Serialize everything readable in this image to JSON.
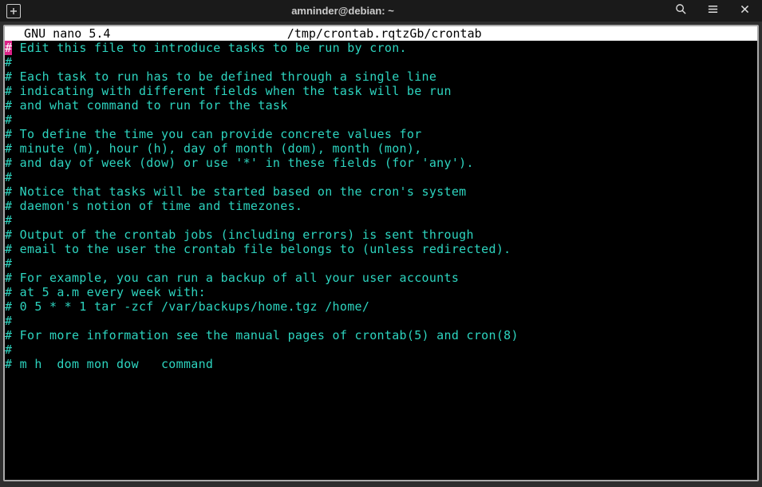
{
  "titlebar": {
    "title": "amninder@debian: ~"
  },
  "nano": {
    "app_name": "  GNU nano 5.4",
    "file_path": "/tmp/crontab.rqtzGb/crontab"
  },
  "content": {
    "lines": [
      {
        "prefix_hl": "#",
        "rest": " Edit this file to introduce tasks to be run by cron."
      },
      {
        "prefix_hl": "",
        "rest": "#"
      },
      {
        "prefix_hl": "",
        "rest": "# Each task to run has to be defined through a single line"
      },
      {
        "prefix_hl": "",
        "rest": "# indicating with different fields when the task will be run"
      },
      {
        "prefix_hl": "",
        "rest": "# and what command to run for the task"
      },
      {
        "prefix_hl": "",
        "rest": "#"
      },
      {
        "prefix_hl": "",
        "rest": "# To define the time you can provide concrete values for"
      },
      {
        "prefix_hl": "",
        "rest": "# minute (m), hour (h), day of month (dom), month (mon),"
      },
      {
        "prefix_hl": "",
        "rest": "# and day of week (dow) or use '*' in these fields (for 'any')."
      },
      {
        "prefix_hl": "",
        "rest": "#"
      },
      {
        "prefix_hl": "",
        "rest": "# Notice that tasks will be started based on the cron's system"
      },
      {
        "prefix_hl": "",
        "rest": "# daemon's notion of time and timezones."
      },
      {
        "prefix_hl": "",
        "rest": "#"
      },
      {
        "prefix_hl": "",
        "rest": "# Output of the crontab jobs (including errors) is sent through"
      },
      {
        "prefix_hl": "",
        "rest": "# email to the user the crontab file belongs to (unless redirected)."
      },
      {
        "prefix_hl": "",
        "rest": "#"
      },
      {
        "prefix_hl": "",
        "rest": "# For example, you can run a backup of all your user accounts"
      },
      {
        "prefix_hl": "",
        "rest": "# at 5 a.m every week with:"
      },
      {
        "prefix_hl": "",
        "rest": "# 0 5 * * 1 tar -zcf /var/backups/home.tgz /home/"
      },
      {
        "prefix_hl": "",
        "rest": "#"
      },
      {
        "prefix_hl": "",
        "rest": "# For more information see the manual pages of crontab(5) and cron(8)"
      },
      {
        "prefix_hl": "",
        "rest": "#"
      },
      {
        "prefix_hl": "",
        "rest": "# m h  dom mon dow   command"
      }
    ]
  }
}
